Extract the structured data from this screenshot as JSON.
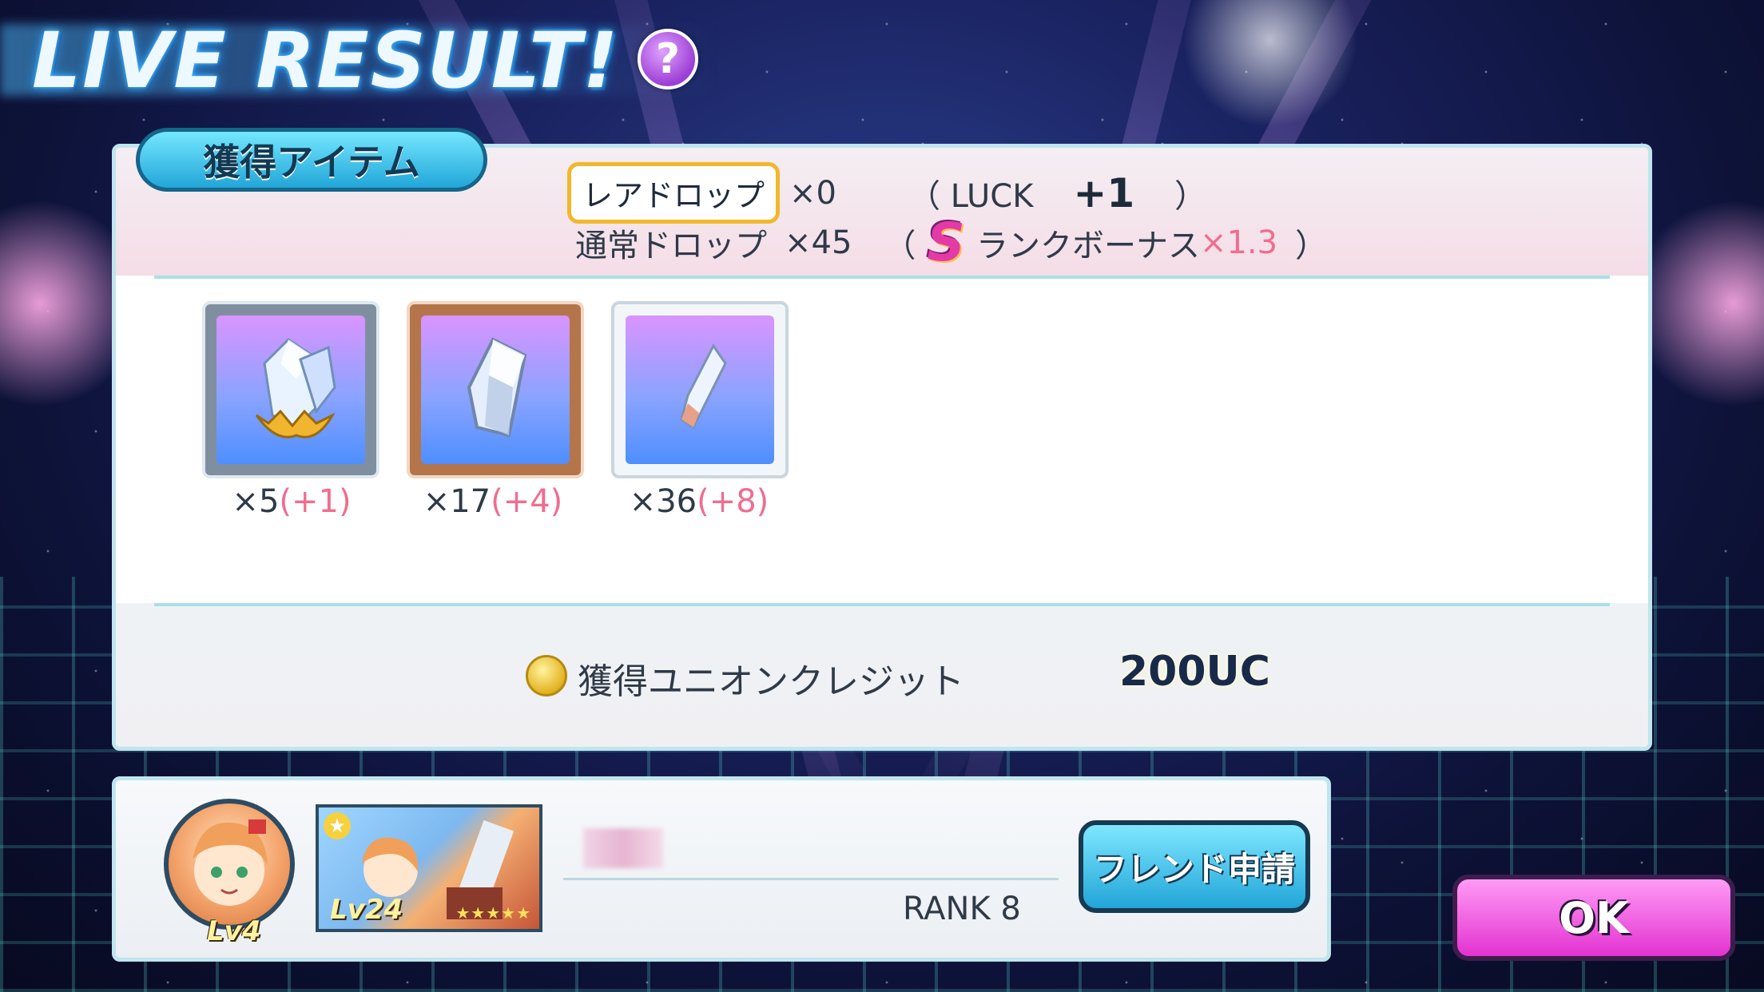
{
  "header": {
    "title": "LIVE RESULT!",
    "help_icon": "?"
  },
  "items_section": {
    "tag_label": "獲得アイテム",
    "rare_drop_label": "レアドロップ",
    "rare_drop_count": "×0",
    "luck_open": "（ LUCK",
    "luck_value": "+1",
    "luck_close": "）",
    "normal_drop_label": "通常ドロップ",
    "normal_drop_count": "×45",
    "bonus_open": "（",
    "rank_letter": "S",
    "rank_bonus_label": "ランクボーナス",
    "rank_bonus_value": "×1.3",
    "bonus_close": "）",
    "items": [
      {
        "icon": "large-crystal-icon",
        "count": "×5",
        "bonus": "(+1)",
        "frame_color": "#7f8fa0"
      },
      {
        "icon": "medium-crystal-icon",
        "count": "×17",
        "bonus": "(+4)",
        "frame_color": "#b4754a"
      },
      {
        "icon": "small-crystal-icon",
        "count": "×36",
        "bonus": "(+8)",
        "frame_color": "#c9d6df"
      }
    ]
  },
  "union_credit": {
    "label": "獲得ユニオンクレジット",
    "value": "200UC",
    "icon": "coin-icon"
  },
  "friend": {
    "avatar_level": "Lv4",
    "card_level": "Lv24",
    "card_stars": "★★★★★",
    "rank": "RANK 8",
    "friend_request_label": "フレンド申請"
  },
  "ok_label": "OK",
  "colors": {
    "accent_pink": "#f06d8f",
    "panel_border": "#bfe5ee",
    "ok_button": "#e332d0",
    "friend_button": "#21a5d8"
  }
}
